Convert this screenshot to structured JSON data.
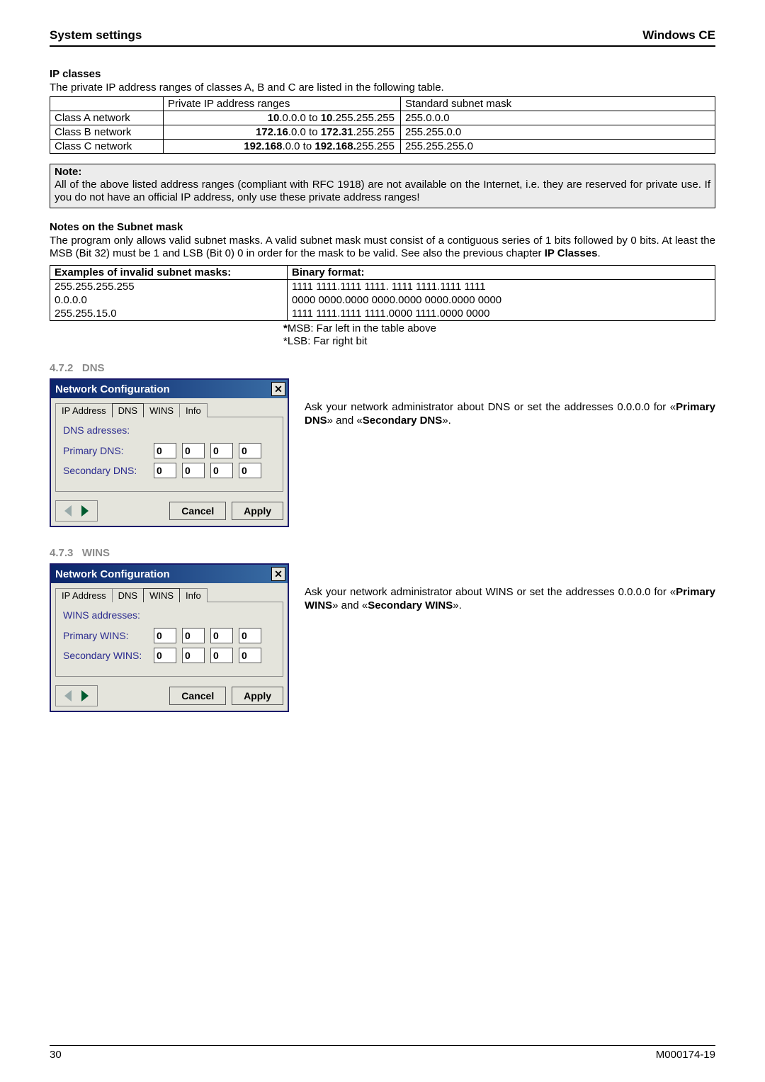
{
  "header": {
    "left": "System settings",
    "right": "Windows CE"
  },
  "ipclasses": {
    "heading": "IP classes",
    "intro": "The private IP address ranges of classes A, B and C are listed in the following table.",
    "col_private": "Private IP address ranges",
    "col_mask": "Standard subnet mask",
    "rows": [
      {
        "label": "Class A network",
        "range_prefix": "10",
        "range_mid": ".0.0.0 to ",
        "range_prefix2": "10",
        "range_suffix": ".255.255.255",
        "mask": "255.0.0.0"
      },
      {
        "label": "Class B network",
        "range_prefix": "172.16",
        "range_mid": ".0.0 to ",
        "range_prefix2": "172.31",
        "range_suffix": ".255.255",
        "mask": "255.255.0.0"
      },
      {
        "label": "Class C network",
        "range_prefix": "192.168",
        "range_mid": ".0.0 to ",
        "range_prefix2": "192.168.",
        "range_suffix": "255.255",
        "mask": "255.255.255.0"
      }
    ]
  },
  "note": {
    "title": "Note:",
    "body": "All of the above listed address ranges (compliant with RFC 1918) are not available on the Internet, i.e. they are reserved for private use. If you do not have an official IP address, only use these private address ranges!"
  },
  "subnet": {
    "heading": "Notes on the Subnet mask",
    "body_pre": "The program only allows valid subnet masks. A valid subnet mask must consist of a contiguous series of 1 bits followed by 0 bits. At least the MSB (Bit 32) must be 1 and LSB (Bit 0) 0 in order for the mask to be valid. See also the previous chapter ",
    "body_bold": "IP Classes",
    "body_post": ".",
    "col_examples": "Examples of invalid subnet masks:",
    "col_binary": "Binary format:",
    "rows": [
      {
        "mask": "255.255.255.255",
        "bin": "1111 1111.1111 1111. 1111 1111.1111 1111"
      },
      {
        "mask": "0.0.0.0",
        "bin": "0000 0000.0000 0000.0000 0000.0000 0000"
      },
      {
        "mask": "255.255.15.0",
        "bin": "1111 1111.1111 1111.0000 1111.0000 0000"
      }
    ],
    "footnote1_star": "*",
    "footnote1": "MSB: Far left in the table above",
    "footnote2": "*LSB: Far right bit"
  },
  "sec_dns": {
    "num": "4.7.2",
    "title": "DNS",
    "dialog_title": "Network Configuration",
    "tabs": [
      "IP Address",
      "DNS",
      "WINS",
      "Info"
    ],
    "active_tab": 1,
    "group": "DNS adresses:",
    "row1": "Primary DNS:",
    "row2": "Secondary DNS:",
    "zeros": [
      "0",
      "0",
      "0",
      "0"
    ],
    "btn_cancel": "Cancel",
    "btn_apply": "Apply",
    "side_pre": "Ask your network administrator about DNS or set the addresses 0.0.0.0 for «",
    "side_b1": "Primary DNS",
    "side_mid": "» and «",
    "side_b2": "Secondary DNS",
    "side_post": "»."
  },
  "sec_wins": {
    "num": "4.7.3",
    "title": "WINS",
    "dialog_title": "Network Configuration",
    "tabs": [
      "IP Address",
      "DNS",
      "WINS",
      "Info"
    ],
    "active_tab": 2,
    "group": "WINS addresses:",
    "row1": "Primary WINS:",
    "row2": "Secondary WINS:",
    "zeros": [
      "0",
      "0",
      "0",
      "0"
    ],
    "btn_cancel": "Cancel",
    "btn_apply": "Apply",
    "side_pre": "Ask your network administrator about WINS or set the addresses 0.0.0.0 for «",
    "side_b1": "Primary WINS",
    "side_mid": "» and «",
    "side_b2": "Secondary WINS",
    "side_post": "»."
  },
  "footer": {
    "left": "30",
    "right": "M000174-19"
  }
}
